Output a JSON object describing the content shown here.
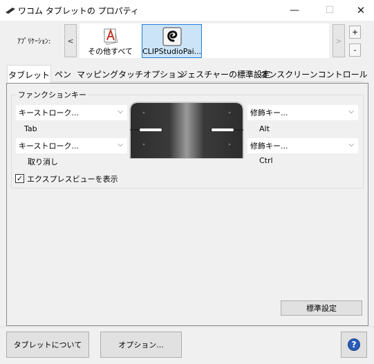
{
  "window": {
    "title": "ワコム タブレットの プロパティ",
    "minimize": "—",
    "maximize": "☐",
    "close": "✕"
  },
  "apps": {
    "label": "ｱﾌﾟﾘｹｰｼｮﾝ:",
    "scroll_left": "<",
    "scroll_right": ">",
    "add": "+",
    "remove": "-",
    "items": [
      {
        "label": "その他すべて",
        "icon": "all-apps-icon"
      },
      {
        "label": "CLIPStudioPai...",
        "icon": "clip-studio-icon",
        "selected": true
      }
    ]
  },
  "tabs": [
    "タブレット",
    "ペン",
    "マッピング",
    "タッチオプション",
    "ジェスチャーの標準設定",
    "オンスクリーンコントロール"
  ],
  "function_keys": {
    "group_label": "ファンクションキー",
    "top_left": {
      "value": "キーストローク...",
      "sub": "Tab"
    },
    "bottom_left": {
      "value": "キーストローク...",
      "sub": "取り消し"
    },
    "top_right": {
      "value": "修飾キー...",
      "sub": "Alt"
    },
    "bottom_right": {
      "value": "修飾キー...",
      "sub": "Ctrl"
    }
  },
  "express_view": {
    "label": "エクスプレスビューを表示",
    "checked": true,
    "mark": "✓"
  },
  "buttons": {
    "defaults": "標準設定",
    "about": "タブレットについて",
    "options": "オプション...",
    "help": "?"
  },
  "colors": {
    "accent": "#1e7ad8",
    "help_blue": "#2a5cb8"
  }
}
